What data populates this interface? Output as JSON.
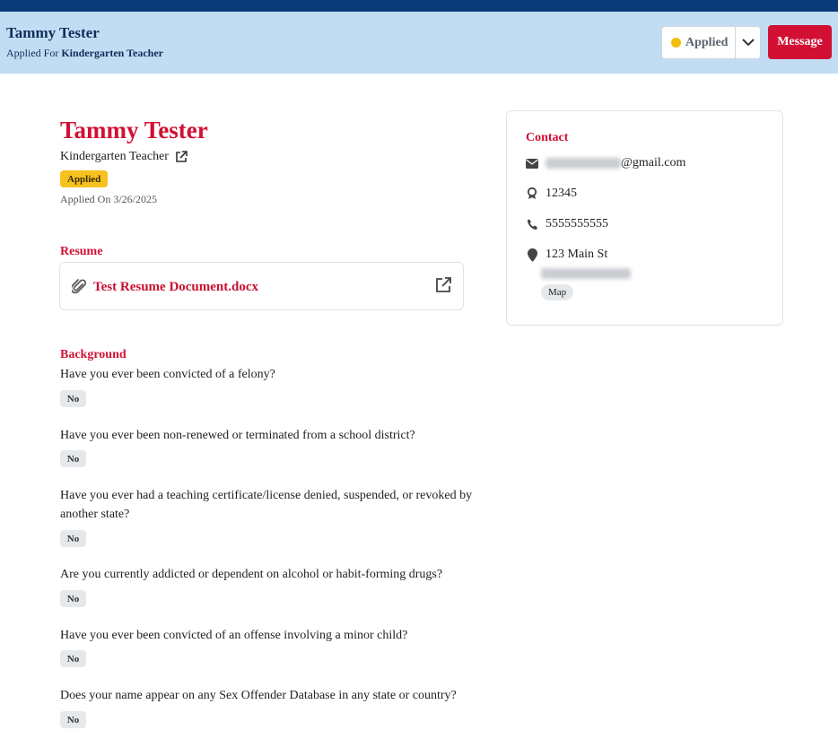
{
  "header": {
    "name": "Tammy Tester",
    "applied_for_prefix": "Applied For",
    "applied_for_position": "Kindergarten Teacher",
    "status_label": "Applied",
    "message_label": "Message"
  },
  "profile": {
    "name": "Tammy Tester",
    "position": "Kindergarten Teacher",
    "status_badge": "Applied",
    "applied_on": "Applied On 3/26/2025"
  },
  "resume": {
    "section_label": "Resume",
    "file_name": "Test Resume Document.docx"
  },
  "background": {
    "section_label": "Background",
    "questions": [
      {
        "text": "Have you ever been convicted of a felony?",
        "answer": "No"
      },
      {
        "text": "Have you ever been non-renewed or terminated from a school district?",
        "answer": "No"
      },
      {
        "text": "Have you ever had a teaching certificate/license denied, suspended, or revoked by another state?",
        "answer": "No"
      },
      {
        "text": "Are you currently addicted or dependent on alcohol or habit-forming drugs?",
        "answer": "No"
      },
      {
        "text": "Have you ever been convicted of an offense involving a minor child?",
        "answer": "No"
      },
      {
        "text": "Does your name appear on any Sex Offender Database in any state or country?",
        "answer": "No"
      }
    ]
  },
  "contact": {
    "section_label": "Contact",
    "email_domain": "@gmail.com",
    "id_number": "12345",
    "phone": "5555555555",
    "address_line1": "123 Main St",
    "map_label": "Map"
  },
  "colors": {
    "top_bar": "#0b3a78",
    "header_bg": "#c2dcf4",
    "accent_red": "#d21033",
    "status_yellow": "#f2bd0b"
  }
}
